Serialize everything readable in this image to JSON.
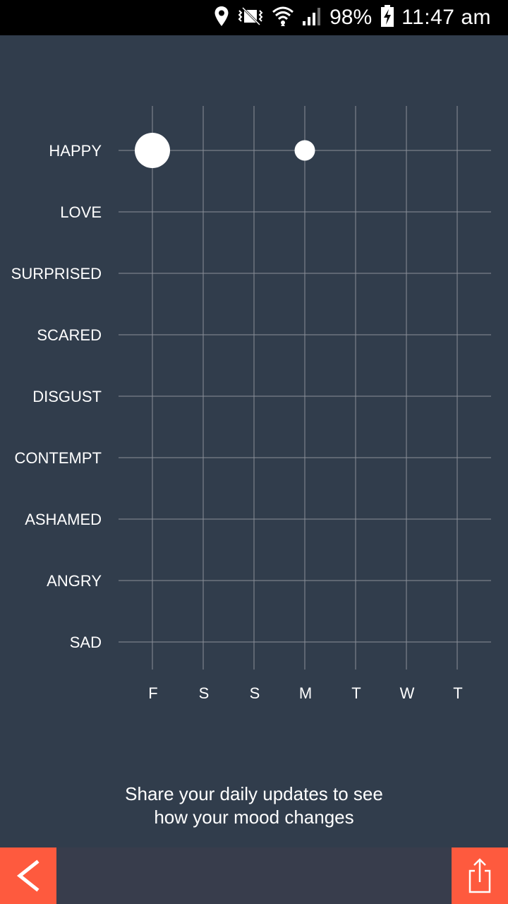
{
  "status_bar": {
    "battery_text": "98%",
    "time": "11:47 am",
    "icons": [
      "location-icon",
      "vibrate-icon",
      "wifi-icon",
      "signal-icon",
      "battery-charging-icon"
    ]
  },
  "chart_data": {
    "type": "scatter",
    "title": "",
    "categories_x": [
      "F",
      "S",
      "S",
      "M",
      "T",
      "W",
      "T"
    ],
    "categories_y": [
      "HAPPY",
      "LOVE",
      "SURPRISED",
      "SCARED",
      "DISGUST",
      "CONTEMPT",
      "ASHAMED",
      "ANGRY",
      "SAD"
    ],
    "points": [
      {
        "x_index": 0,
        "y": "HAPPY",
        "relative_size": 1.0
      },
      {
        "x_index": 3,
        "y": "HAPPY",
        "relative_size": 0.58
      }
    ],
    "grid": true,
    "colors": {
      "background": "#313d4c",
      "grid": "#8a9099",
      "point": "#ffffff"
    }
  },
  "hint": {
    "line1": "Share your daily updates to see",
    "line2": "how your mood changes"
  },
  "bottom_bar": {
    "back_icon": "chevron-left-icon",
    "share_icon": "share-icon",
    "accent": "#fe5a3e"
  }
}
